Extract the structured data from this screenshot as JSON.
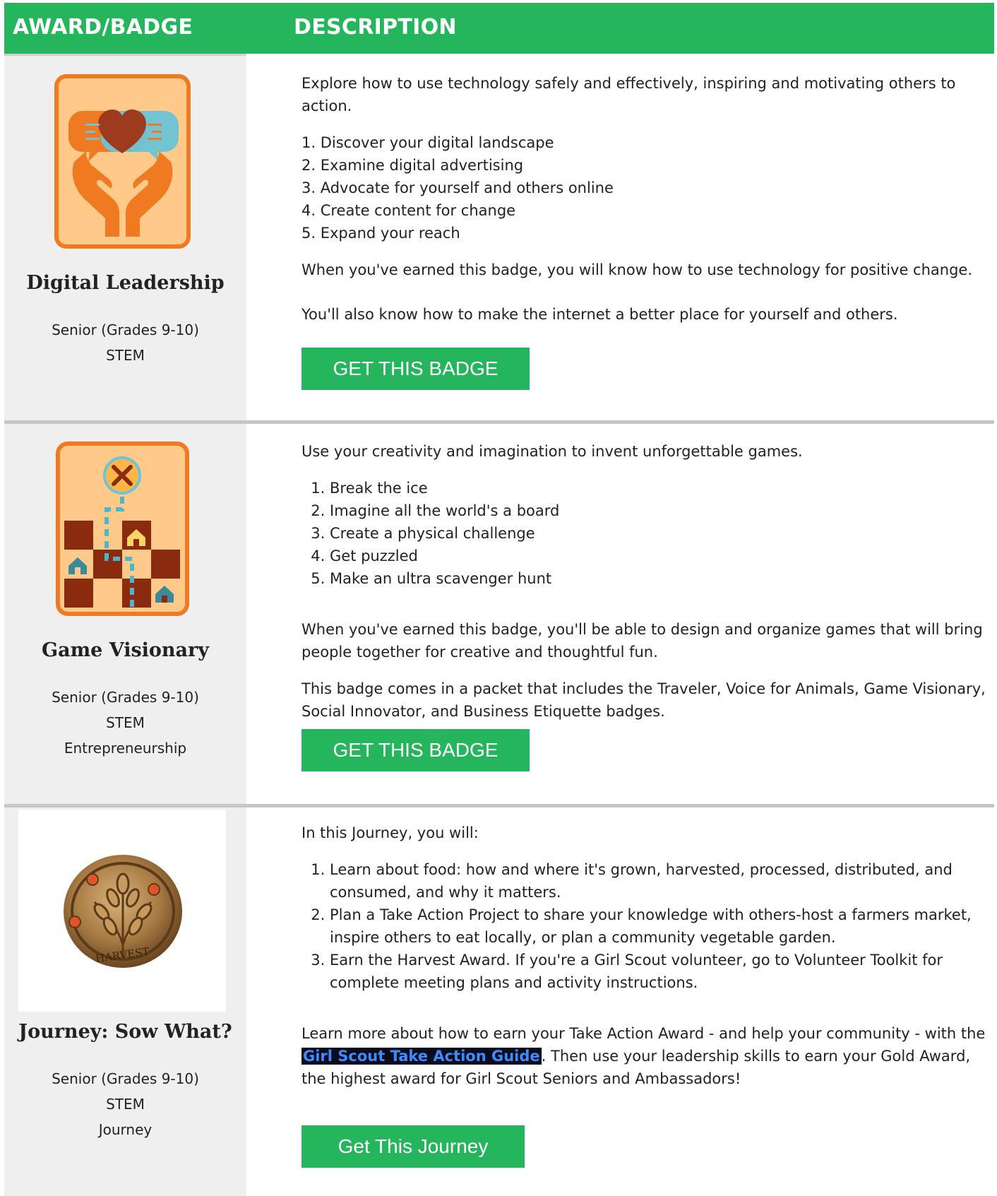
{
  "header": {
    "col1_title": "AWARD/BADGE",
    "col2_title": "DESCRIPTION",
    "bg_color": "#25b55c"
  },
  "rows": [
    {
      "badge_name": "Digital Leadership",
      "icon": "digital-leadership-badge-icon",
      "meta": [
        "Senior (Grades 9-10)",
        "STEM"
      ],
      "intro": "Explore how to use technology safely and effectively, inspiring and motivating others to action.",
      "steps": [
        "1. Discover your digital landscape",
        "2. Examine digital advertising",
        "3. Advocate for yourself and others online",
        "4. Create content for change",
        "5. Expand your reach"
      ],
      "outro1": "When you've earned this badge, you will know how to use technology for positive change.",
      "outro2": "You'll also know how to make the internet a better place for yourself and others.",
      "button_label": "GET THIS BADGE"
    },
    {
      "badge_name": "Game Visionary",
      "icon": "game-visionary-badge-icon",
      "meta": [
        "Senior (Grades 9-10)",
        "STEM",
        "Entrepreneurship"
      ],
      "intro": "Use your creativity and imagination to invent unforgettable games.",
      "steps": [
        "Break the ice",
        "Imagine all the world's a board",
        "Create a physical challenge",
        "Get puzzled",
        "Make an ultra scavenger hunt"
      ],
      "outro1": "When you've earned this badge, you'll be able to design and organize games that will bring people together for creative and thoughtful fun.",
      "outro2": "This badge comes in a packet that includes the Traveler, Voice for Animals, Game Visionary, Social Innovator, and Business Etiquette badges.",
      "button_label": "GET THIS BADGE"
    },
    {
      "badge_name": "Journey: Sow What?",
      "icon": "harvest-pin-icon",
      "pin_text": "HARVEST",
      "meta": [
        "Senior (Grades 9-10)",
        "STEM",
        "Journey"
      ],
      "intro": "In this Journey, you will:",
      "steps": [
        "Learn about food: how and where it's grown, harvested, processed, distributed, and consumed, and why it matters.",
        "Plan a Take Action Project to share your knowledge with others-host a farmers market, inspire others to eat locally, or plan a community vegetable garden.",
        "Earn the Harvest Award. If you're a Girl Scout volunteer, go to Volunteer Toolkit for complete meeting plans and activity instructions."
      ],
      "outro_before_link": "Learn more about how to earn your Take Action Award - and help your community - with the ",
      "link_text": "Girl Scout Take Action Guide",
      "outro_after_link": ". Then use your leadership skills to earn your Gold Award, the highest award for Girl Scout Seniors and Ambassadors!",
      "button_label": "Get This Journey"
    }
  ]
}
